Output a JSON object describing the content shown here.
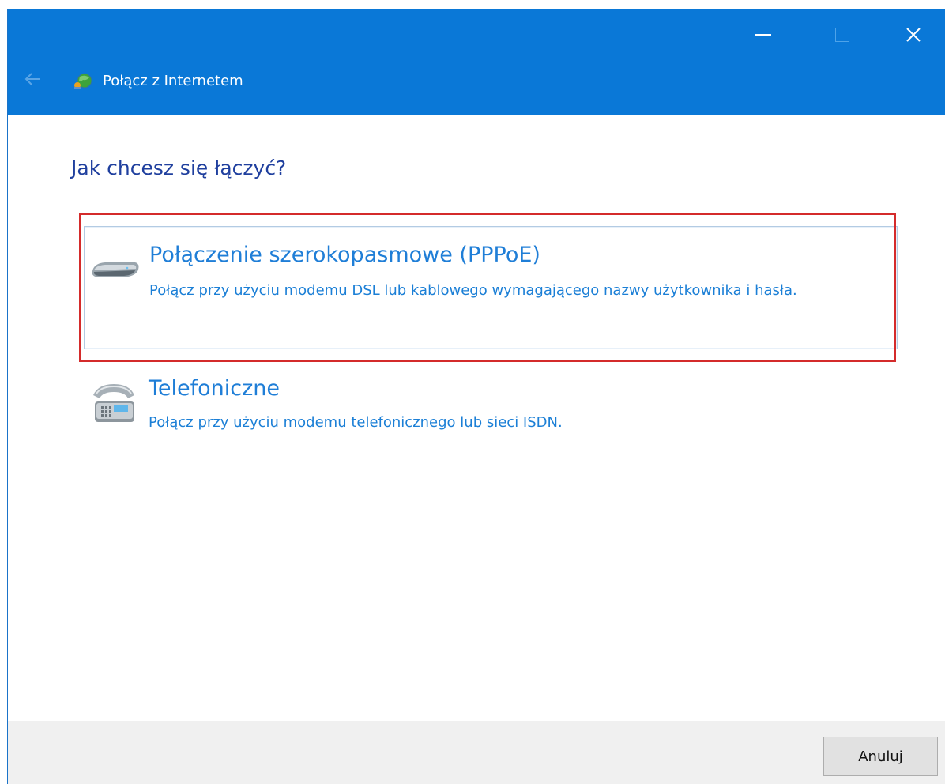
{
  "window": {
    "title": "Połącz z Internetem",
    "titlebar_color": "#0a78d7"
  },
  "heading": "Jak chcesz się łączyć?",
  "options": [
    {
      "title": "Połączenie szerokopasmowe (PPPoE)",
      "description": "Połącz przy użyciu modemu DSL lub kablowego wymagającego nazwy użytkownika i hasła.",
      "icon": "modem-icon",
      "highlighted": true
    },
    {
      "title": "Telefoniczne",
      "description": "Połącz przy użyciu modemu telefonicznego lub sieci ISDN.",
      "icon": "phone-icon",
      "highlighted": false
    }
  ],
  "footer": {
    "cancel_label": "Anuluj"
  },
  "colors": {
    "highlight": "#d42b2b",
    "link_text": "#1f7ed7",
    "heading_text": "#1f3f9e"
  }
}
